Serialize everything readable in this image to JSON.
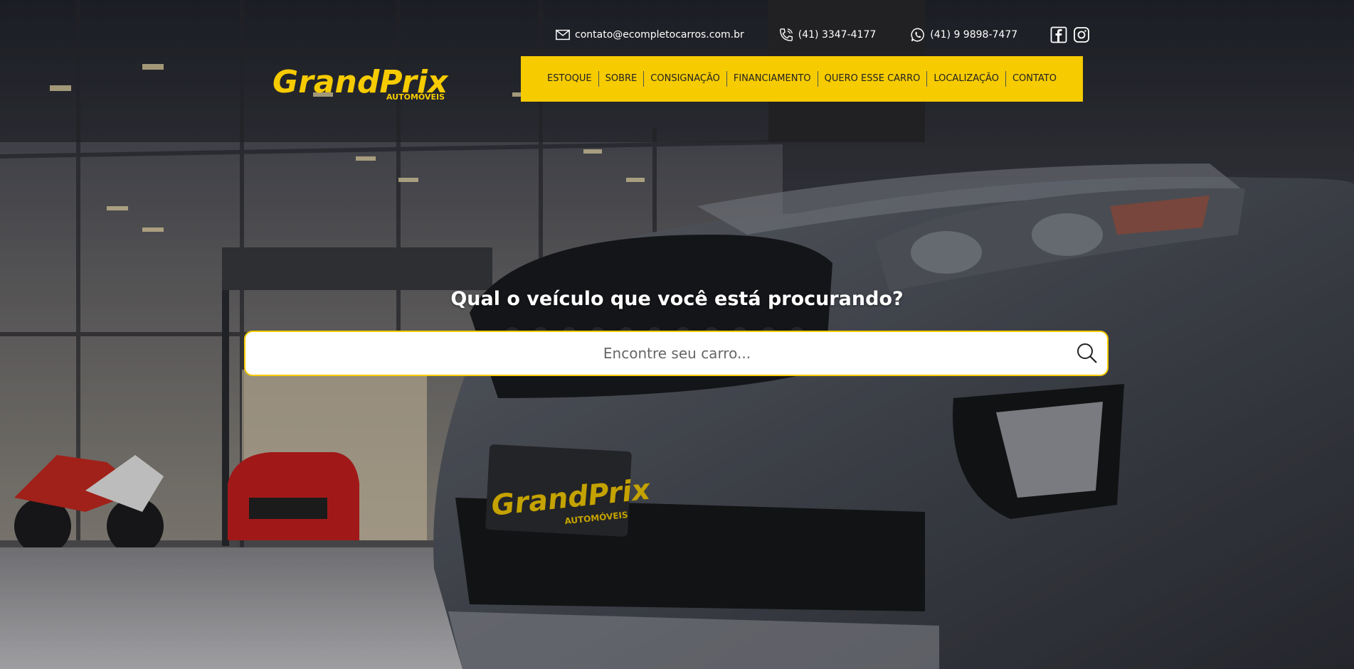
{
  "header": {
    "email": "contato@ecompletocarros.com.br",
    "phone": "(41) 3347-4177",
    "whatsapp": "(41) 9 9898-7477",
    "social": [
      "facebook-icon",
      "instagram-icon"
    ]
  },
  "logo": {
    "text_main": "GrandPrix",
    "text_sub": "AUTOMÓVEIS",
    "color": "#f6cb00"
  },
  "nav": {
    "bg": "#f6cb00",
    "items": [
      {
        "label": "ESTOQUE"
      },
      {
        "label": "SOBRE"
      },
      {
        "label": "CONSIGNAÇÃO"
      },
      {
        "label": "FINANCIAMENTO"
      },
      {
        "label": "QUERO ESSE CARRO"
      },
      {
        "label": "LOCALIZAÇÃO"
      },
      {
        "label": "CONTATO"
      }
    ]
  },
  "search": {
    "heading": "Qual o veículo que você está procurando?",
    "placeholder": "Encontre seu carro...",
    "icon": "search-icon"
  },
  "plate": {
    "text_main": "GrandPrix",
    "text_sub": "AUTOMÓVEIS"
  }
}
